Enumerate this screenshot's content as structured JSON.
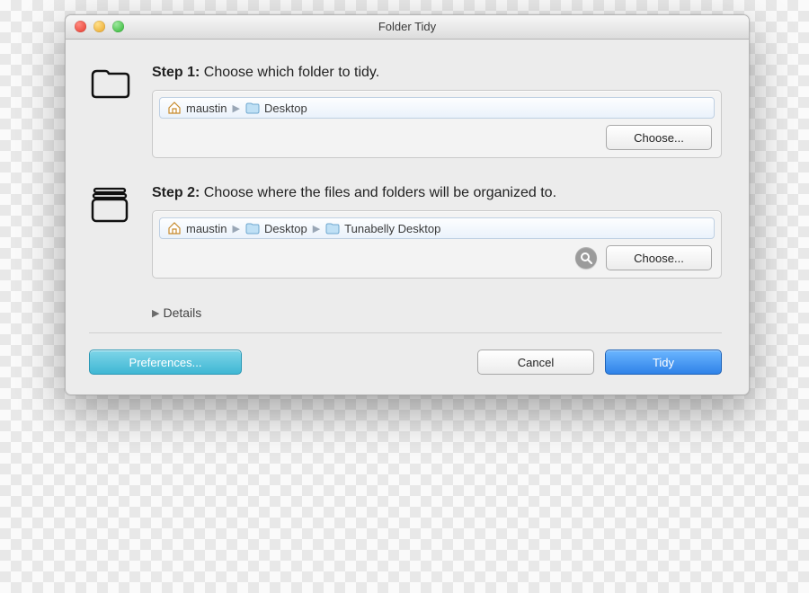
{
  "window": {
    "title": "Folder Tidy"
  },
  "step1": {
    "label_bold": "Step 1:",
    "label_rest": " Choose which folder to tidy.",
    "path": [
      "maustin",
      "Desktop"
    ],
    "choose": "Choose..."
  },
  "step2": {
    "label_bold": "Step 2:",
    "label_rest": " Choose where the files and folders will be organized to.",
    "path": [
      "maustin",
      "Desktop",
      "Tunabelly Desktop"
    ],
    "choose": "Choose..."
  },
  "details": "Details",
  "footer": {
    "prefs": "Preferences...",
    "cancel": "Cancel",
    "tidy": "Tidy"
  }
}
